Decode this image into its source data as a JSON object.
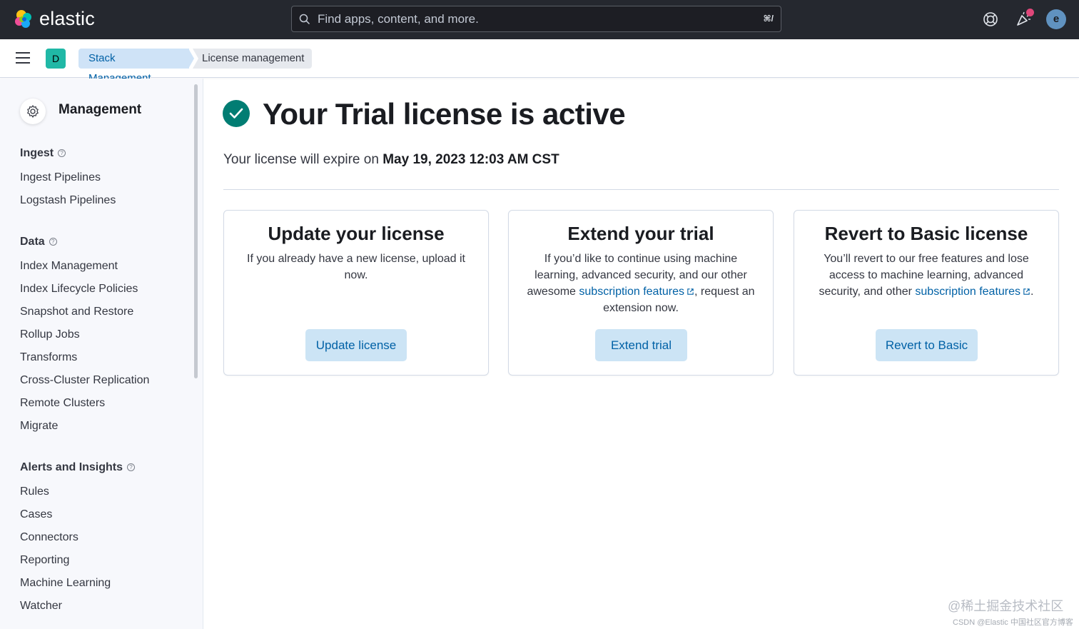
{
  "header": {
    "brand": "elastic",
    "search_placeholder": "Find apps, content, and more.",
    "search_shortcut": "⌘/",
    "avatar_initial": "e",
    "icons": [
      "help-icon",
      "newsfeed-icon"
    ]
  },
  "subheader": {
    "space_initial": "D",
    "breadcrumbs": [
      "Stack Management",
      "License management"
    ]
  },
  "sidebar": {
    "title": "Management",
    "sections": [
      {
        "title": "Ingest",
        "items": [
          "Ingest Pipelines",
          "Logstash Pipelines"
        ]
      },
      {
        "title": "Data",
        "items": [
          "Index Management",
          "Index Lifecycle Policies",
          "Snapshot and Restore",
          "Rollup Jobs",
          "Transforms",
          "Cross-Cluster Replication",
          "Remote Clusters",
          "Migrate"
        ]
      },
      {
        "title": "Alerts and Insights",
        "items": [
          "Rules",
          "Cases",
          "Connectors",
          "Reporting",
          "Machine Learning",
          "Watcher"
        ]
      }
    ]
  },
  "main": {
    "title": "Your Trial license is active",
    "expire_prefix": "Your license will expire on ",
    "expire_date": "May 19, 2023 12:03 AM CST",
    "cards": [
      {
        "title": "Update your license",
        "desc": "If you already have a new license, upload it now.",
        "button": "Update license"
      },
      {
        "title": "Extend your trial",
        "desc_before": "If you’d like to continue using machine learning, advanced security, and our other awesome ",
        "link": "subscription features",
        "desc_after": ", request an extension now.",
        "button": "Extend trial"
      },
      {
        "title": "Revert to Basic license",
        "desc_before": "You’ll revert to our free features and lose access to machine learning, advanced security, and other ",
        "link": "subscription features",
        "desc_after": ".",
        "button": "Revert to Basic"
      }
    ]
  },
  "watermark": {
    "line1": "@稀土掘金技术社区",
    "line2": "CSDN @Elastic 中国社区官方博客"
  },
  "colors": {
    "header_bg": "#25282f",
    "accent": "#0061a6",
    "success": "#017d73",
    "space_badge": "#20b8a6",
    "button_bg": "#cce4f5"
  }
}
